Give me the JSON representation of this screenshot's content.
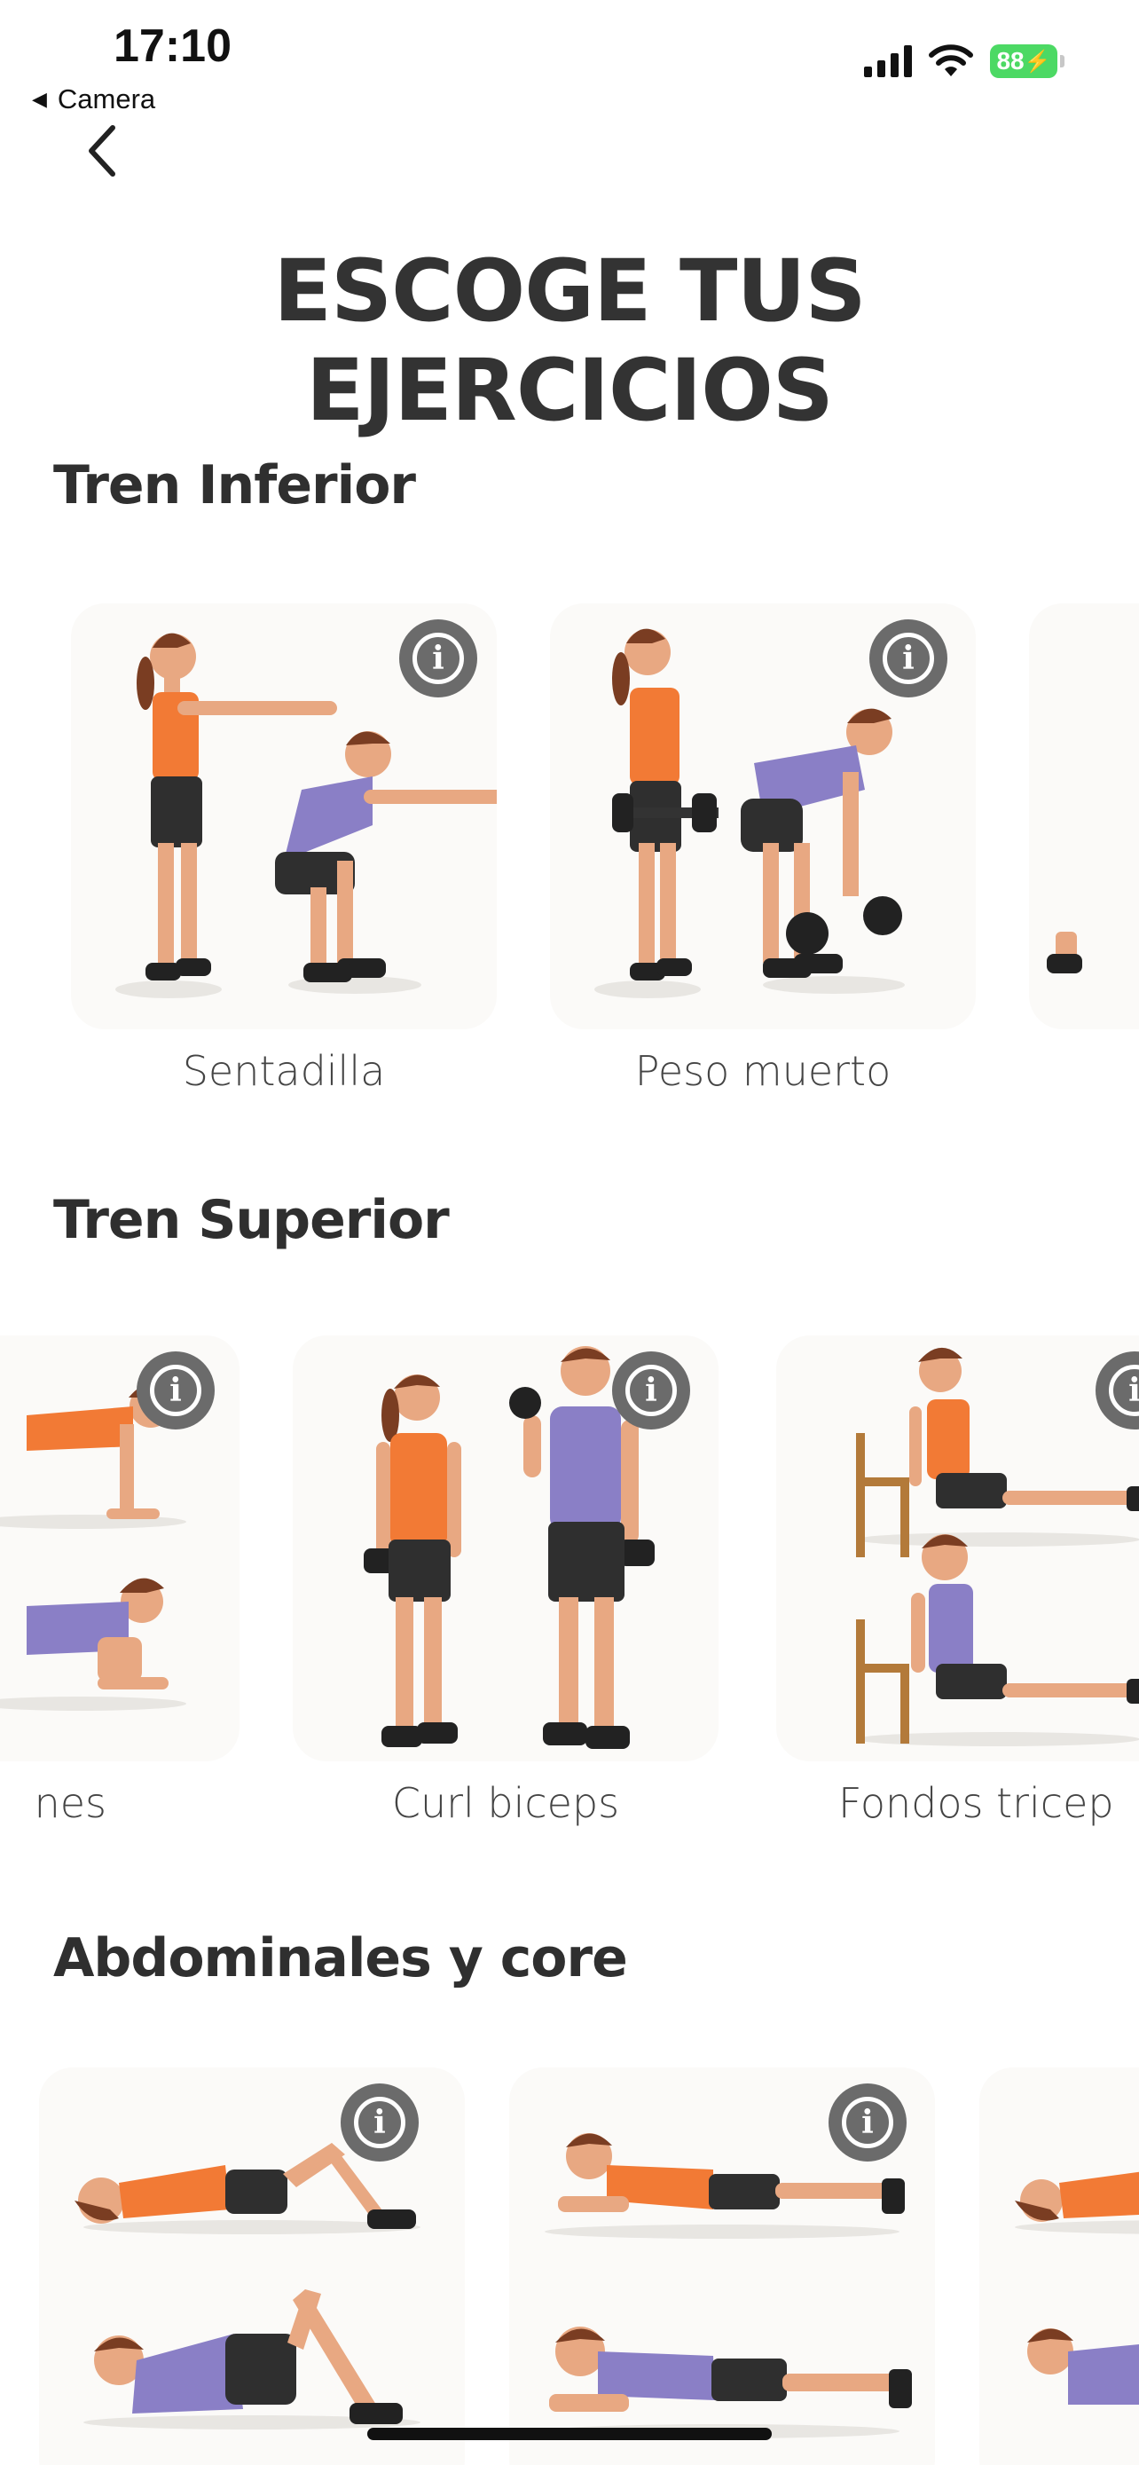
{
  "status_bar": {
    "time": "17:10",
    "back_app": "Camera",
    "battery": "88"
  },
  "header": {
    "title": "ESCOGE TUS EJERCICIOS"
  },
  "sections": [
    {
      "title": "Tren Inferior",
      "items": [
        {
          "label": "Sentadilla"
        },
        {
          "label": "Peso muerto"
        }
      ]
    },
    {
      "title": "Tren Superior",
      "items": [
        {
          "label": "nes"
        },
        {
          "label": "Curl biceps"
        },
        {
          "label": "Fondos tricep"
        }
      ]
    },
    {
      "title": "Abdominales y core",
      "items": []
    }
  ],
  "colors": {
    "orange": "#f27a35",
    "purple": "#8a7fc6",
    "skin": "#e8a882",
    "hair": "#7a3d22",
    "shorts": "#2f2f2f",
    "info_button": "#6b6b6b"
  }
}
